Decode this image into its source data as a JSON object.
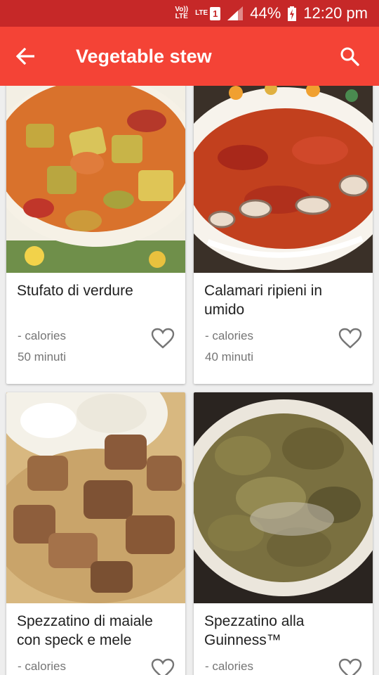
{
  "status_bar": {
    "volte": "Vo))",
    "volte_lte": "LTE",
    "lte": "LTE",
    "sim": "1",
    "battery": "44%",
    "time": "12:20 pm"
  },
  "app_bar": {
    "title": "Vegetable stew",
    "back_icon": "arrow-back-icon",
    "search_icon": "search-icon"
  },
  "recipes": [
    {
      "title": "Stufato di verdure",
      "calories": "- calories",
      "time": "50 minuti"
    },
    {
      "title": "Calamari ripieni in umido",
      "calories": "- calories",
      "time": "40 minuti"
    },
    {
      "title": "Spezzatino di maiale con speck e mele",
      "calories": "- calories",
      "time": ""
    },
    {
      "title": "Spezzatino alla Guinness™",
      "calories": "- calories",
      "time": ""
    }
  ],
  "colors": {
    "status_bar": "#c62828",
    "app_bar": "#f44336",
    "background": "#eeeeee"
  }
}
